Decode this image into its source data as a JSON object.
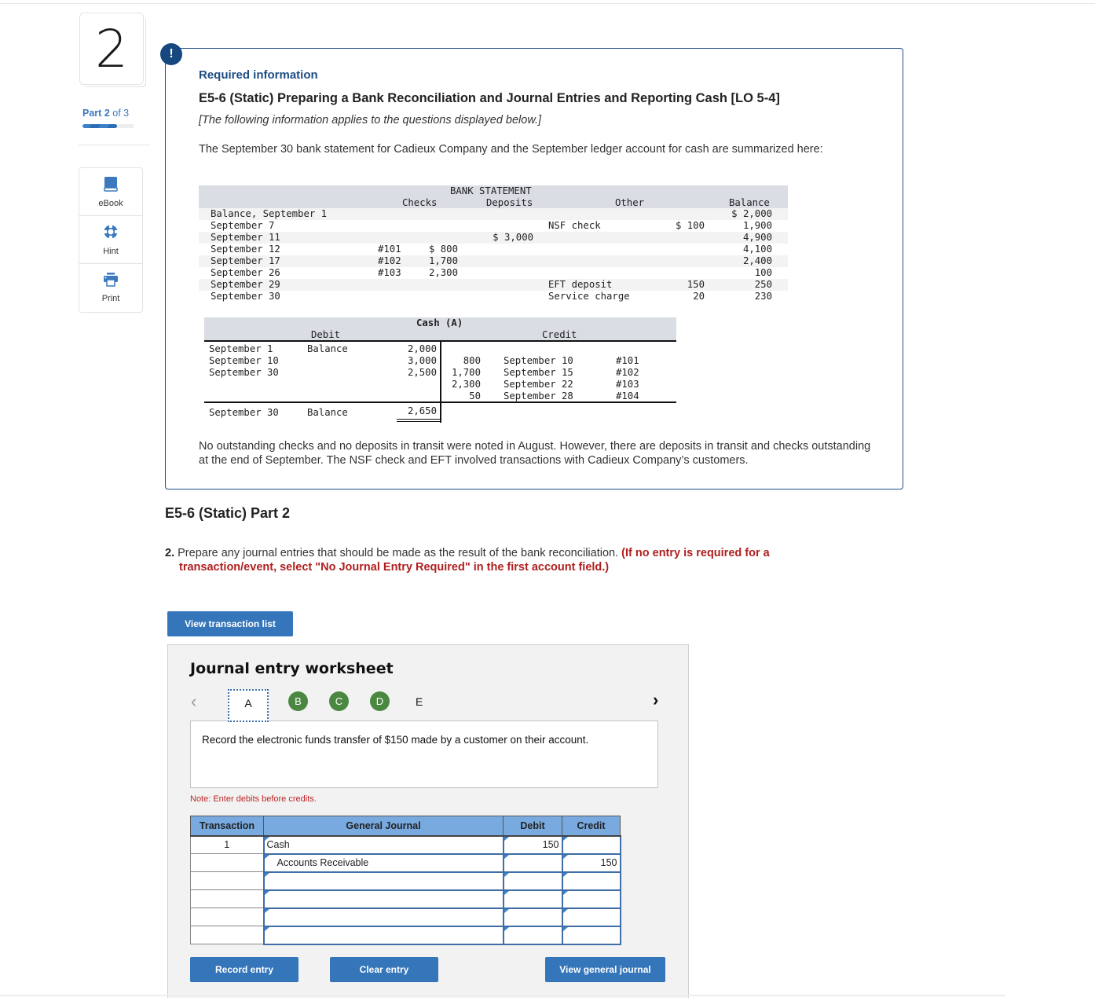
{
  "rail": {
    "question_number": "2",
    "part_label_prefix": "Part",
    "part_current": "2",
    "part_suffix": "of 3",
    "part_progress_fraction": 0.667,
    "tools": [
      {
        "label": "eBook",
        "icon": "book-icon"
      },
      {
        "label": "Hint",
        "icon": "lifebuoy-icon"
      },
      {
        "label": "Print",
        "icon": "printer-icon"
      }
    ]
  },
  "info": {
    "alert_symbol": "!",
    "required_label": "Required information",
    "title": "E5-6 (Static) Preparing a Bank Reconciliation and Journal Entries and Reporting Cash [LO 5-4]",
    "subtitle": "[The following information applies to the questions displayed below.]",
    "intro": "The September 30 bank statement for Cadieux Company and the September ledger account for cash are summarized here:",
    "note": "No outstanding checks and no deposits in transit were noted in August. However, there are deposits in transit and checks outstanding at the end of September. The NSF check and EFT involved transactions with Cadieux Company’s customers."
  },
  "bank_statement": {
    "title": "BANK STATEMENT",
    "headers": {
      "checks": "Checks",
      "deposits": "Deposits",
      "other": "Other",
      "balance": "Balance"
    },
    "rows": [
      {
        "date": "Balance, September 1",
        "check_no": "",
        "check_amt": "",
        "deposit": "",
        "other_desc": "",
        "other_amt": "",
        "balance": "$ 2,000"
      },
      {
        "date": "September 7",
        "check_no": "",
        "check_amt": "",
        "deposit": "",
        "other_desc": "NSF check",
        "other_amt": "$ 100",
        "balance": "1,900"
      },
      {
        "date": "September 11",
        "check_no": "",
        "check_amt": "",
        "deposit": "$ 3,000",
        "other_desc": "",
        "other_amt": "",
        "balance": "4,900"
      },
      {
        "date": "September 12",
        "check_no": "#101",
        "check_amt": "$ 800",
        "deposit": "",
        "other_desc": "",
        "other_amt": "",
        "balance": "4,100"
      },
      {
        "date": "September 17",
        "check_no": "#102",
        "check_amt": "1,700",
        "deposit": "",
        "other_desc": "",
        "other_amt": "",
        "balance": "2,400"
      },
      {
        "date": "September 26",
        "check_no": "#103",
        "check_amt": "2,300",
        "deposit": "",
        "other_desc": "",
        "other_amt": "",
        "balance": "100"
      },
      {
        "date": "September 29",
        "check_no": "",
        "check_amt": "",
        "deposit": "",
        "other_desc": "EFT deposit",
        "other_amt": "150",
        "balance": "250"
      },
      {
        "date": "September 30",
        "check_no": "",
        "check_amt": "",
        "deposit": "",
        "other_desc": "Service charge",
        "other_amt": "20",
        "balance": "230"
      }
    ]
  },
  "cash_account": {
    "title": "Cash (A)",
    "debit_label": "Debit",
    "credit_label": "Credit",
    "debits": [
      {
        "date": "September 1",
        "desc": "Balance",
        "amount": "2,000"
      },
      {
        "date": "September 10",
        "desc": "",
        "amount": "3,000"
      },
      {
        "date": "September 30",
        "desc": "",
        "amount": "2,500"
      }
    ],
    "credits": [
      {
        "amount": "800",
        "date": "September 10",
        "ref": "#101"
      },
      {
        "amount": "1,700",
        "date": "September 15",
        "ref": "#102"
      },
      {
        "amount": "2,300",
        "date": "September 22",
        "ref": "#103"
      },
      {
        "amount": "50",
        "date": "September 28",
        "ref": "#104"
      }
    ],
    "ending": {
      "date": "September 30",
      "desc": "Balance",
      "amount": "2,650"
    }
  },
  "part2": {
    "title": "E5-6 (Static) Part 2",
    "question_number": "2.",
    "question_text": "Prepare any journal entries that should be made as the result of the bank reconciliation.",
    "question_instruction": "(If no entry is required for a transaction/event, select \"No Journal Entry Required\" in the first account field.)",
    "view_transaction_list": "View transaction list"
  },
  "worksheet": {
    "title": "Journal entry worksheet",
    "tabs": [
      {
        "label": "A",
        "state": "active"
      },
      {
        "label": "B",
        "state": "completed"
      },
      {
        "label": "C",
        "state": "completed"
      },
      {
        "label": "D",
        "state": "completed"
      },
      {
        "label": "E",
        "state": "pending"
      }
    ],
    "description": "Record the electronic funds transfer of $150 made by a customer on their account.",
    "note": "Note: Enter debits before credits.",
    "columns": [
      "Transaction",
      "General Journal",
      "Debit",
      "Credit"
    ],
    "rows": [
      {
        "transaction": "1",
        "account": "Cash",
        "indent": false,
        "debit": "150",
        "credit": ""
      },
      {
        "transaction": "",
        "account": "Accounts Receivable",
        "indent": true,
        "debit": "",
        "credit": "150"
      },
      {
        "transaction": "",
        "account": "",
        "indent": false,
        "debit": "",
        "credit": ""
      },
      {
        "transaction": "",
        "account": "",
        "indent": false,
        "debit": "",
        "credit": ""
      },
      {
        "transaction": "",
        "account": "",
        "indent": false,
        "debit": "",
        "credit": ""
      },
      {
        "transaction": "",
        "account": "",
        "indent": false,
        "debit": "",
        "credit": ""
      }
    ],
    "buttons": {
      "record": "Record entry",
      "clear": "Clear entry",
      "view_journal": "View general journal"
    }
  },
  "colors": {
    "brand_blue": "#3575b9",
    "info_border": "#1f4f86",
    "completed_tab": "#4a8740",
    "instruction_red": "#b01e1e",
    "journal_header": "#78a9df"
  }
}
